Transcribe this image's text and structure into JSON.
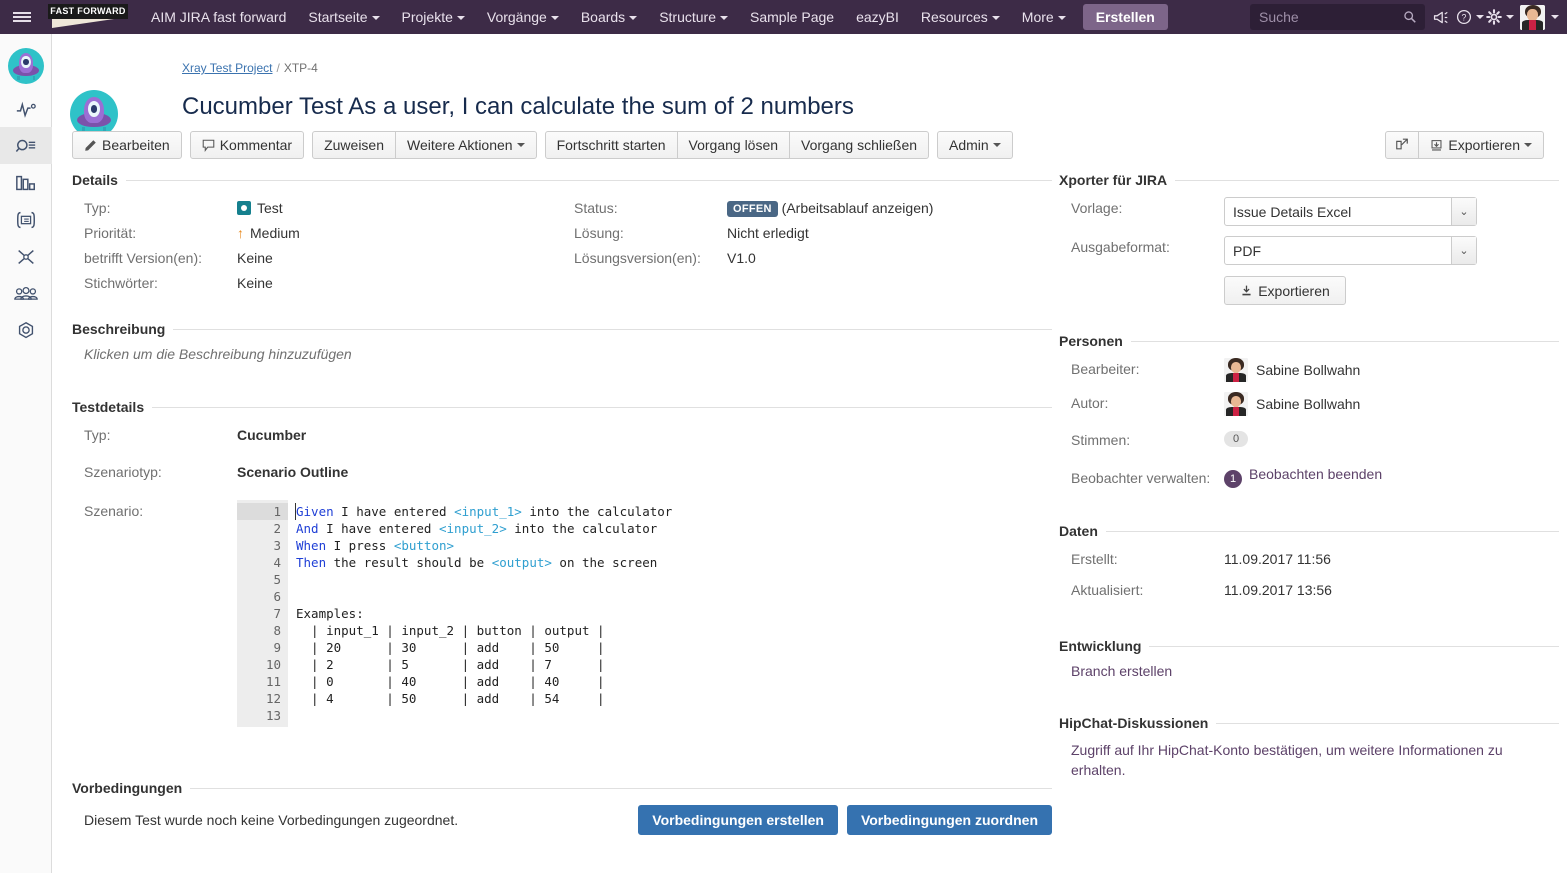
{
  "topnav": {
    "hamburger": "menu-icon",
    "logo_text": "FAST FORWARD",
    "items": [
      {
        "label": "AIM JIRA fast forward",
        "caret": false
      },
      {
        "label": "Startseite",
        "caret": true
      },
      {
        "label": "Projekte",
        "caret": true
      },
      {
        "label": "Vorgänge",
        "caret": true
      },
      {
        "label": "Boards",
        "caret": true
      },
      {
        "label": "Structure",
        "caret": true
      },
      {
        "label": "Sample Page",
        "caret": false
      },
      {
        "label": "eazyBI",
        "caret": false
      },
      {
        "label": "Resources",
        "caret": true
      },
      {
        "label": "More",
        "caret": true
      }
    ],
    "create_label": "Erstellen",
    "search_placeholder": "Suche",
    "search_value": ""
  },
  "leftrail": {
    "items": [
      {
        "name": "project-avatar",
        "icon": "xray-logo-icon"
      },
      {
        "name": "activity",
        "icon": "pulse-icon"
      },
      {
        "name": "issues-search",
        "icon": "magnifier-list-icon"
      },
      {
        "name": "reports",
        "icon": "bar-chart-icon"
      },
      {
        "name": "test-repository",
        "icon": "document-list-icon"
      },
      {
        "name": "xray-tools",
        "icon": "x-scissors-icon"
      },
      {
        "name": "people",
        "icon": "people-icon"
      },
      {
        "name": "project-settings",
        "icon": "gear-hex-icon"
      }
    ]
  },
  "breadcrumb": {
    "project": "Xray Test Project",
    "separator": "/",
    "issue_key": "XTP-4"
  },
  "issue": {
    "title": "Cucumber Test As a user, I can calculate the sum of 2 numbers"
  },
  "toolbar": {
    "edit": "Bearbeiten",
    "comment": "Kommentar",
    "assign": "Zuweisen",
    "more_actions": "Weitere Aktionen",
    "start_progress": "Fortschritt starten",
    "resolve": "Vorgang lösen",
    "close": "Vorgang schließen",
    "admin": "Admin",
    "share": "share-icon",
    "export": "Exportieren"
  },
  "details": {
    "heading": "Details",
    "left": [
      {
        "label": "Typ:",
        "value": "Test",
        "icon": "test-type-icon"
      },
      {
        "label": "Priorität:",
        "value": "Medium",
        "icon": "priority-medium-arrow"
      },
      {
        "label": "betrifft Version(en):",
        "value": "Keine"
      },
      {
        "label": "Stichwörter:",
        "value": "Keine"
      }
    ],
    "right": [
      {
        "label": "Status:",
        "value": "OFFEN",
        "suffix": "(Arbeitsablauf anzeigen)"
      },
      {
        "label": "Lösung:",
        "value": "Nicht erledigt"
      },
      {
        "label": "Lösungsversion(en):",
        "value": "V1.0"
      }
    ]
  },
  "description": {
    "heading": "Beschreibung",
    "placeholder": "Klicken um die Beschreibung hinzuzufügen"
  },
  "testdetails": {
    "heading": "Testdetails",
    "type_label": "Typ:",
    "type_value": "Cucumber",
    "scenario_type_label": "Szenariotyp:",
    "scenario_type_value": "Scenario Outline",
    "scenario_label": "Szenario:",
    "line_count": 13,
    "lines": [
      {
        "n": 1,
        "segments": [
          {
            "t": "Given",
            "c": "kw"
          },
          {
            "t": " I have entered ",
            "c": ""
          },
          {
            "t": "<input_1>",
            "c": "ph"
          },
          {
            "t": " into the calculator",
            "c": ""
          }
        ]
      },
      {
        "n": 2,
        "segments": [
          {
            "t": "And",
            "c": "kw"
          },
          {
            "t": " I have entered ",
            "c": ""
          },
          {
            "t": "<input_2>",
            "c": "ph"
          },
          {
            "t": " into the calculator",
            "c": ""
          }
        ]
      },
      {
        "n": 3,
        "segments": [
          {
            "t": "When",
            "c": "kw"
          },
          {
            "t": " I press ",
            "c": ""
          },
          {
            "t": "<button>",
            "c": "ph"
          }
        ]
      },
      {
        "n": 4,
        "segments": [
          {
            "t": "Then",
            "c": "kw"
          },
          {
            "t": " the result should be ",
            "c": ""
          },
          {
            "t": "<output>",
            "c": "ph"
          },
          {
            "t": " on the screen",
            "c": ""
          }
        ]
      },
      {
        "n": 5,
        "segments": []
      },
      {
        "n": 6,
        "segments": []
      },
      {
        "n": 7,
        "segments": [
          {
            "t": "Examples:",
            "c": ""
          }
        ]
      },
      {
        "n": 8,
        "segments": [
          {
            "t": "  | input_1 | input_2 | button | output |",
            "c": ""
          }
        ]
      },
      {
        "n": 9,
        "segments": [
          {
            "t": "  | 20      | 30      | add    | 50     |",
            "c": ""
          }
        ]
      },
      {
        "n": 10,
        "segments": [
          {
            "t": "  | 2       | 5       | add    | 7      |",
            "c": ""
          }
        ]
      },
      {
        "n": 11,
        "segments": [
          {
            "t": "  | 0       | 40      | add    | 40     |",
            "c": ""
          }
        ]
      },
      {
        "n": 12,
        "segments": [
          {
            "t": "  | 4       | 50      | add    | 54     |",
            "c": ""
          }
        ]
      },
      {
        "n": 13,
        "segments": []
      }
    ],
    "examples_table": {
      "headers": [
        "input_1",
        "input_2",
        "button",
        "output"
      ],
      "rows": [
        [
          "20",
          "30",
          "add",
          "50"
        ],
        [
          "2",
          "5",
          "add",
          "7"
        ],
        [
          "0",
          "40",
          "add",
          "40"
        ],
        [
          "4",
          "50",
          "add",
          "54"
        ]
      ]
    }
  },
  "preconditions": {
    "heading": "Vorbedingungen",
    "empty_text": "Diesem Test wurde noch keine Vorbedingungen zugeordnet.",
    "create_label": "Vorbedingungen erstellen",
    "assign_label": "Vorbedingungen zuordnen"
  },
  "xporter": {
    "heading": "Xporter für JIRA",
    "template_label": "Vorlage:",
    "template_value": "Issue Details Excel",
    "format_label": "Ausgabeformat:",
    "format_value": "PDF",
    "export_label": "Exportieren"
  },
  "people": {
    "heading": "Personen",
    "assignee_label": "Bearbeiter:",
    "assignee_value": "Sabine Bollwahn",
    "reporter_label": "Autor:",
    "reporter_value": "Sabine Bollwahn",
    "votes_label": "Stimmen:",
    "votes_value": "0",
    "watchers_label": "Beobachter verwalten:",
    "watchers_count": "1",
    "watchers_action": "Beobachten beenden"
  },
  "dates": {
    "heading": "Daten",
    "created_label": "Erstellt:",
    "created_value": "11.09.2017 11:56",
    "updated_label": "Aktualisiert:",
    "updated_value": "11.09.2017 13:56"
  },
  "development": {
    "heading": "Entwicklung",
    "link": "Branch erstellen"
  },
  "hipchat": {
    "heading": "HipChat-Diskussionen",
    "text": "Zugriff auf Ihr HipChat-Konto bestätigen, um weitere Informationen zu erhalten."
  },
  "colors": {
    "nav_bg": "#3d2b47",
    "create_btn": "#7d6589",
    "link_blue": "#3b73af",
    "primary_btn": "#3572b0",
    "status_lozenge": "#4a6785",
    "type_icon": "#15808e",
    "priority": "#e8891e",
    "watch_badge": "#5d4269",
    "keyword": "#1f3fd6",
    "placeholder_token": "#2f9fd0"
  }
}
